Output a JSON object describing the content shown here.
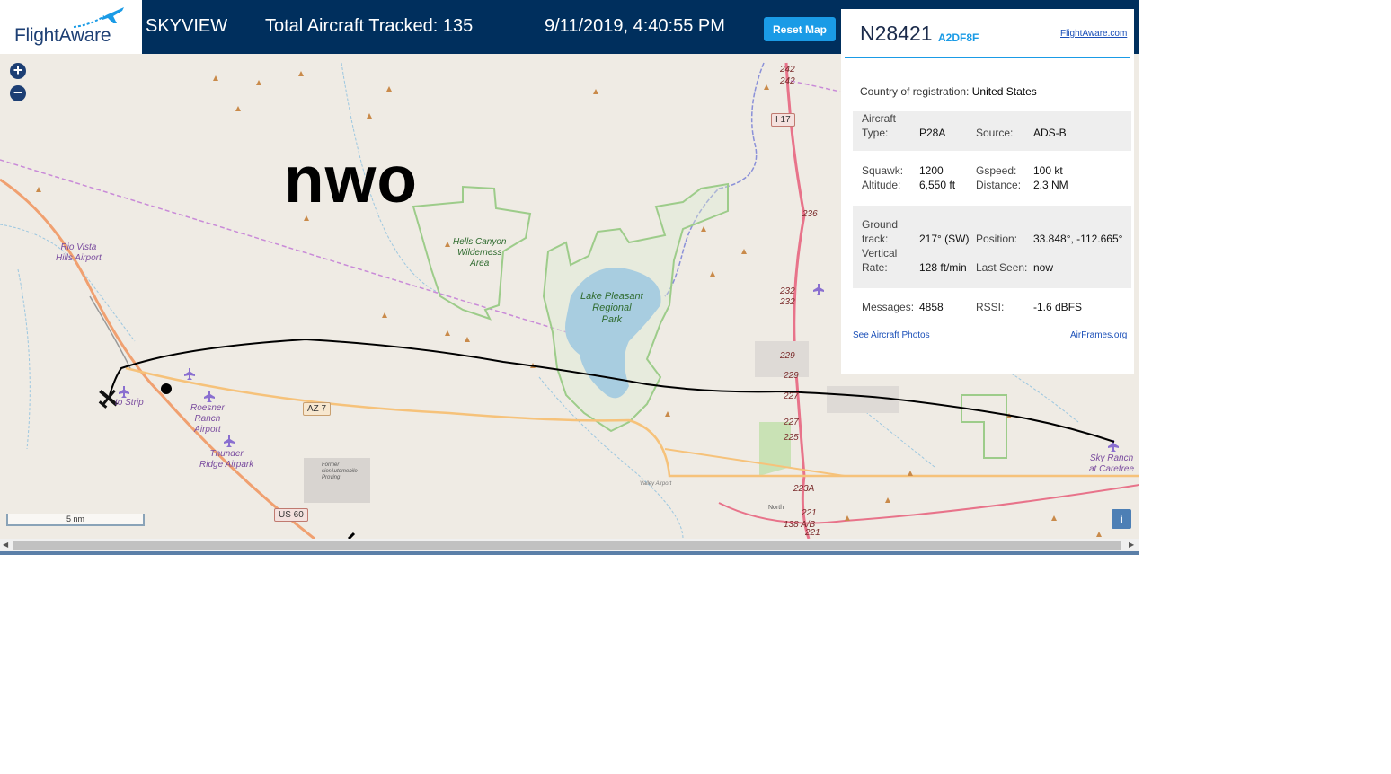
{
  "header": {
    "logo_text": "FlightAware",
    "app_name": "SKYVIEW",
    "total_tracked_label": "Total Aircraft Tracked: 135",
    "datetime": "9/11/2019, 4:40:55 PM",
    "reset_button": "Reset Map"
  },
  "map": {
    "overlay_text": "nwo",
    "zoom_in": "+",
    "zoom_out": "−",
    "scale": "5 nm",
    "info_button": "i",
    "airports": {
      "rio_vista": "Rio Vista\nHills Airport",
      "strip": "to Strip",
      "roesner": "Roesner\nRanch\nAirport",
      "thunder": "Thunder\nRidge Airpark",
      "sky_ranch": "Sky Ranch\nat Carefree"
    },
    "parks": {
      "hells_canyon": "Hells Canyon\nWilderness\nArea",
      "lake_pleasant": "Lake Pleasant\nRegional\nPark"
    },
    "roads": {
      "i17": "I 17",
      "az": "AZ 7",
      "us60": "US 60"
    },
    "mile_markers": {
      "m242a": "242",
      "m242b": "242",
      "m236": "236",
      "m232a": "232",
      "m232b": "232",
      "m229a": "229",
      "m229b": "229",
      "m227a": "227",
      "m227b": "227",
      "m225": "225",
      "m223": "223A",
      "m221a": "221",
      "m221b": "221",
      "m138": "138 A/B"
    },
    "small_labels": {
      "former": "Former\nsierAutomobile\nProving",
      "valley": "Valley Airport",
      "north": "North"
    }
  },
  "panel": {
    "tail": "N28421",
    "hex": "A2DF8F",
    "fa_link": "FlightAware.com",
    "country_label": "Country of registration:",
    "country_value": "United States",
    "aircraft_type_label": "Aircraft\nType:",
    "aircraft_type_value": "P28A",
    "source_label": "Source:",
    "source_value": "ADS-B",
    "squawk_label": "Squawk:",
    "squawk_value": "1200",
    "altitude_label": "Altitude:",
    "altitude_value": "6,550 ft",
    "gspeed_label": "Gspeed:",
    "gspeed_value": "100 kt",
    "distance_label": "Distance:",
    "distance_value": "2.3 NM",
    "ground_track_label": "Ground\ntrack:",
    "ground_track_value": "217° (SW)",
    "vrate_label": "Vertical\nRate:",
    "vrate_value": "128 ft/min",
    "position_label": "Position:",
    "position_value": "33.848°, -112.665°",
    "last_seen_label": "Last Seen:",
    "last_seen_value": "now",
    "messages_label": "Messages:",
    "messages_value": "4858",
    "rssi_label": "RSSI:",
    "rssi_value": "-1.6 dBFS",
    "photos_link": "See Aircraft Photos",
    "airframes_link": "AirFrames.org"
  },
  "colors": {
    "header_bg": "#002f5d",
    "accent": "#1a9be6",
    "map_bg": "#efebe4",
    "track": "#000000",
    "interstate": "#e8738a",
    "park": "#9dcc8a",
    "lake": "#a8cde0"
  }
}
